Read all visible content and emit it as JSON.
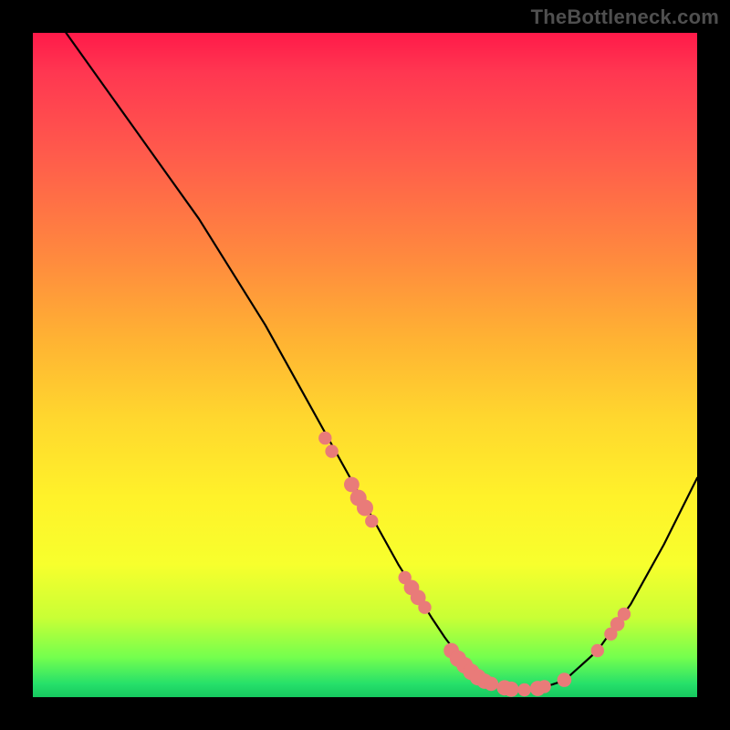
{
  "watermark": "TheBottleneck.com",
  "colors": {
    "frame": "#000000",
    "curve": "#000000",
    "marker": "#e97b79",
    "gradient_top": "#ff1a49",
    "gradient_bottom": "#16c85f"
  },
  "chart_data": {
    "type": "line",
    "title": "",
    "xlabel": "",
    "ylabel": "",
    "xlim": [
      0,
      100
    ],
    "ylim": [
      0,
      100
    ],
    "curve": {
      "x": [
        5,
        10,
        15,
        20,
        25,
        30,
        35,
        40,
        45,
        50,
        55,
        60,
        62,
        65,
        68,
        70,
        73,
        76,
        80,
        85,
        90,
        95,
        100
      ],
      "y": [
        100,
        93,
        86,
        79,
        72,
        64,
        56,
        47,
        38,
        29,
        20,
        12,
        9,
        5,
        2.5,
        1.5,
        1,
        1.2,
        2.5,
        7,
        14,
        23,
        33
      ]
    },
    "markers": [
      {
        "x": 44,
        "y": 39,
        "r": 1.2
      },
      {
        "x": 45,
        "y": 37,
        "r": 1.2
      },
      {
        "x": 48,
        "y": 32,
        "r": 1.4
      },
      {
        "x": 49,
        "y": 30,
        "r": 1.5
      },
      {
        "x": 50,
        "y": 28.5,
        "r": 1.5
      },
      {
        "x": 51,
        "y": 26.5,
        "r": 1.2
      },
      {
        "x": 56,
        "y": 18,
        "r": 1.2
      },
      {
        "x": 57,
        "y": 16.5,
        "r": 1.4
      },
      {
        "x": 58,
        "y": 15,
        "r": 1.4
      },
      {
        "x": 59,
        "y": 13.5,
        "r": 1.2
      },
      {
        "x": 63,
        "y": 7,
        "r": 1.4
      },
      {
        "x": 64,
        "y": 5.8,
        "r": 1.5
      },
      {
        "x": 65,
        "y": 4.8,
        "r": 1.5
      },
      {
        "x": 66,
        "y": 3.8,
        "r": 1.5
      },
      {
        "x": 67,
        "y": 3,
        "r": 1.5
      },
      {
        "x": 68,
        "y": 2.4,
        "r": 1.4
      },
      {
        "x": 69,
        "y": 2,
        "r": 1.3
      },
      {
        "x": 71,
        "y": 1.4,
        "r": 1.4
      },
      {
        "x": 72,
        "y": 1.2,
        "r": 1.4
      },
      {
        "x": 74,
        "y": 1.1,
        "r": 1.2
      },
      {
        "x": 76,
        "y": 1.3,
        "r": 1.4
      },
      {
        "x": 77,
        "y": 1.6,
        "r": 1.2
      },
      {
        "x": 80,
        "y": 2.6,
        "r": 1.3
      },
      {
        "x": 85,
        "y": 7,
        "r": 1.2
      },
      {
        "x": 87,
        "y": 9.5,
        "r": 1.2
      },
      {
        "x": 88,
        "y": 11,
        "r": 1.3
      },
      {
        "x": 89,
        "y": 12.5,
        "r": 1.2
      }
    ]
  }
}
